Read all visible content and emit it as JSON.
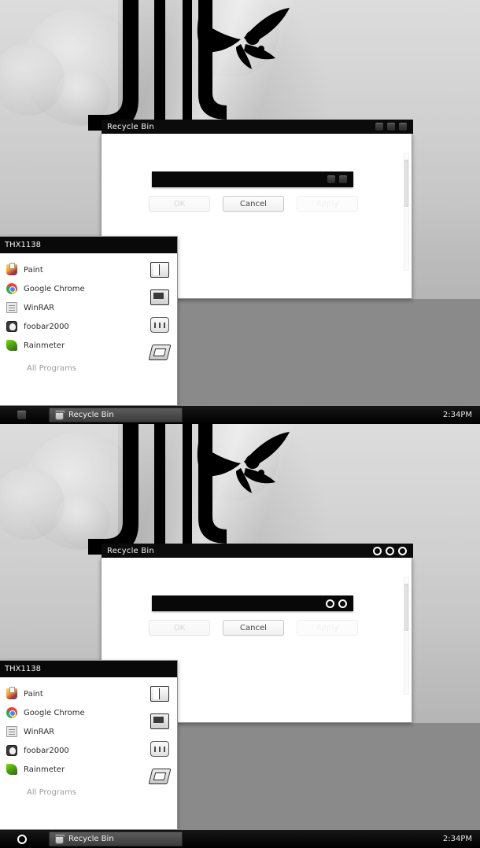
{
  "theme_preview": {
    "panes": [
      {
        "id": "top-pane",
        "button_style": "embossed-square",
        "window": {
          "title": "Recycle Bin",
          "title_buttons": [
            "minimize-button",
            "maximize-button",
            "close-button"
          ],
          "inner_bar_buttons": [
            "inner-minimize-button",
            "inner-close-button"
          ],
          "dialog_buttons": [
            {
              "label": "OK",
              "state": "disabled"
            },
            {
              "label": "Cancel",
              "state": "enabled"
            },
            {
              "label": "Apply",
              "state": "disabled"
            }
          ],
          "scrollbar": "vertical-scrollbar"
        },
        "start_menu": {
          "user": "THX1138",
          "programs": [
            {
              "label": "Paint",
              "icon": "paint-icon"
            },
            {
              "label": "Google Chrome",
              "icon": "chrome-icon"
            },
            {
              "label": "WinRAR",
              "icon": "winrar-icon"
            },
            {
              "label": "foobar2000",
              "icon": "foobar2000-icon"
            },
            {
              "label": "Rainmeter",
              "icon": "rainmeter-icon"
            }
          ],
          "all_programs": "All Programs",
          "shell_icons": [
            "documents-icon",
            "computer-icon",
            "control-panel-icon",
            "devices-icon"
          ]
        },
        "taskbar": {
          "start_glyph": "square",
          "task_label": "Recycle Bin",
          "task_icon": "recycle-bin-icon",
          "clock": "2:34PM"
        }
      },
      {
        "id": "bottom-pane",
        "button_style": "white-ring",
        "window": {
          "title": "Recycle Bin",
          "title_buttons": [
            "minimize-button",
            "maximize-button",
            "close-button"
          ],
          "inner_bar_buttons": [
            "inner-minimize-button",
            "inner-close-button"
          ],
          "dialog_buttons": [
            {
              "label": "OK",
              "state": "disabled"
            },
            {
              "label": "Cancel",
              "state": "enabled"
            },
            {
              "label": "Apply",
              "state": "disabled"
            }
          ],
          "scrollbar": "vertical-scrollbar"
        },
        "start_menu": {
          "user": "THX1138",
          "programs": [
            {
              "label": "Paint",
              "icon": "paint-icon"
            },
            {
              "label": "Google Chrome",
              "icon": "chrome-icon"
            },
            {
              "label": "WinRAR",
              "icon": "winrar-icon"
            },
            {
              "label": "foobar2000",
              "icon": "foobar2000-icon"
            },
            {
              "label": "Rainmeter",
              "icon": "rainmeter-icon"
            }
          ],
          "all_programs": "All Programs",
          "shell_icons": [
            "documents-icon",
            "computer-icon",
            "control-panel-icon",
            "devices-icon"
          ]
        },
        "taskbar": {
          "start_glyph": "ring",
          "task_label": "Recycle Bin",
          "task_icon": "recycle-bin-icon",
          "clock": "2:34PM"
        }
      }
    ],
    "colors": {
      "titlebar_bg": "#0b0b0b",
      "taskbar_bg": "#0a0a0a",
      "window_bg": "#ffffff",
      "desktop_grey": "#8a8a8a",
      "text_light": "#f2f2f2",
      "disabled_text": "#d6d6d6"
    }
  }
}
